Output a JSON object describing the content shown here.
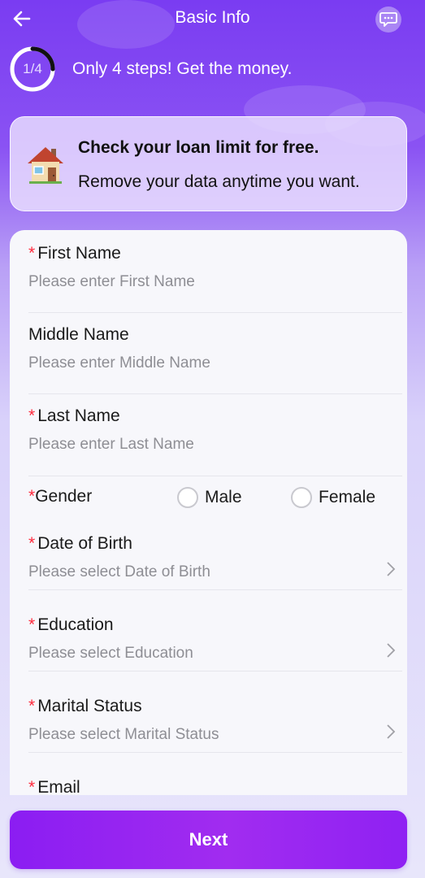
{
  "header": {
    "title": "Basic Info"
  },
  "progress": {
    "label": "1/4",
    "current_step": 1,
    "total_steps": 4,
    "fraction": 0.25,
    "text": "Only 4 steps! Get the money."
  },
  "promo": {
    "title": "Check your loan limit for free.",
    "subtitle": "Remove your data anytime you want."
  },
  "form": {
    "required_mark": "*",
    "first_name": {
      "label": "First Name",
      "placeholder": "Please enter First Name"
    },
    "middle_name": {
      "label": "Middle Name",
      "placeholder": "Please enter Middle Name"
    },
    "last_name": {
      "label": "Last Name",
      "placeholder": "Please enter Last Name"
    },
    "gender": {
      "label": "Gender",
      "options": [
        "Male",
        "Female"
      ]
    },
    "dob": {
      "label": "Date of Birth",
      "placeholder": "Please select Date of Birth"
    },
    "education": {
      "label": "Education",
      "placeholder": "Please select Education"
    },
    "marital": {
      "label": "Marital Status",
      "placeholder": "Please select Marital Status"
    },
    "email": {
      "label": "Email"
    }
  },
  "footer": {
    "next_label": "Next"
  },
  "colors": {
    "accent": "#8b1df2",
    "required": "#ff2a3d",
    "header_bg": "#7a3cf2"
  },
  "icons": {
    "back": "arrow-left-icon",
    "chat": "chat-bubble-icon",
    "house": "house-icon",
    "chevron": "chevron-right-icon"
  }
}
